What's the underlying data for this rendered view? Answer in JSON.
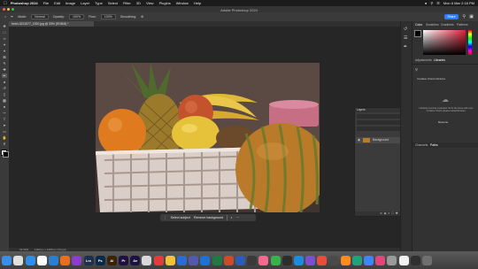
{
  "menubar": {
    "items": [
      "Photoshop 2024",
      "File",
      "Edit",
      "Image",
      "Layer",
      "Type",
      "Select",
      "Filter",
      "3D",
      "View",
      "Plugins",
      "Window",
      "Help"
    ],
    "clock": "Mon 6 Mar  2:18 PM"
  },
  "window": {
    "title": "Adobe Photoshop 2024"
  },
  "options": {
    "mode_label": "Mode:",
    "mode_value": "Normal",
    "opacity_label": "Opacity:",
    "opacity_value": "100%",
    "flow_label": "Flow:",
    "flow_value": "100%",
    "smoothing_label": "Smoothing:",
    "share_label": "Share"
  },
  "document": {
    "tab_title": "fresh-3221577_1920.jpg @ 33% (RGB/8) *"
  },
  "status": {
    "zoom": "33.33%",
    "info": "1920 px x 1280 px (72 ppi)"
  },
  "taskbar": {
    "select_subject": "Select subject",
    "remove_background": "Remove background"
  },
  "layers": {
    "header": "Layers",
    "layer_name": "Background"
  },
  "right_panel": {
    "tabs_top": [
      "Color",
      "Swatches",
      "Gradients",
      "Patterns"
    ],
    "tabs_mid": [
      "Adjustments",
      "Libraries"
    ],
    "libraries_title": "Creative Cloud Libraries",
    "libraries_msg": "Libraries syncing is paused. To fix the issue with your Creative Cloud, please reload libraries.",
    "resume_label": "Resume",
    "tabs_bottom": [
      "Channels",
      "Paths"
    ]
  },
  "dock_apps": [
    {
      "name": "Finder",
      "color": "#3a8ee6",
      "label": ""
    },
    {
      "name": "Launchpad",
      "color": "#e0e0e0",
      "label": ""
    },
    {
      "name": "Safari",
      "color": "#2f8fe8",
      "label": ""
    },
    {
      "name": "Chrome",
      "color": "#ffffff",
      "label": ""
    },
    {
      "name": "VS Code",
      "color": "#2a7fd1",
      "label": ""
    },
    {
      "name": "Firefox",
      "color": "#e8701c",
      "label": ""
    },
    {
      "name": "App1",
      "color": "#8a3ec9",
      "label": ""
    },
    {
      "name": "Lightroom Classic",
      "color": "#1d2f4a",
      "label": "Lrc"
    },
    {
      "name": "Photoshop",
      "color": "#0a2a4a",
      "label": "Ps"
    },
    {
      "name": "Illustrator",
      "color": "#3a2306",
      "label": "Ai"
    },
    {
      "name": "Premiere",
      "color": "#1f1040",
      "label": "Pr"
    },
    {
      "name": "After Effects",
      "color": "#1c1240",
      "label": "Ae"
    },
    {
      "name": "App2",
      "color": "#d8d8d8",
      "label": ""
    },
    {
      "name": "App3",
      "color": "#e23c3c",
      "label": ""
    },
    {
      "name": "App4",
      "color": "#f2c33a",
      "label": ""
    },
    {
      "name": "App5",
      "color": "#2b6bd6",
      "label": ""
    },
    {
      "name": "Teams",
      "color": "#5558af",
      "label": ""
    },
    {
      "name": "Outlook",
      "color": "#1e72d2",
      "label": ""
    },
    {
      "name": "Excel",
      "color": "#1f7a44",
      "label": ""
    },
    {
      "name": "PowerPoint",
      "color": "#cf4a26",
      "label": ""
    },
    {
      "name": "Word",
      "color": "#2b5cb7",
      "label": ""
    },
    {
      "name": "App6",
      "color": "#3a3a3a",
      "label": ""
    },
    {
      "name": "App7",
      "color": "#f26a8d",
      "label": ""
    },
    {
      "name": "App8",
      "color": "#37b24d",
      "label": ""
    },
    {
      "name": "App9",
      "color": "#2d2d2d",
      "label": ""
    },
    {
      "name": "App10",
      "color": "#1c8be0",
      "label": ""
    },
    {
      "name": "App11",
      "color": "#7b4fd1",
      "label": ""
    },
    {
      "name": "App12",
      "color": "#e84c3d",
      "label": ""
    },
    {
      "name": "App13",
      "color": "#4a4a4a",
      "label": ""
    },
    {
      "name": "App14",
      "color": "#ff8c1a",
      "label": ""
    },
    {
      "name": "App15",
      "color": "#1fa37a",
      "label": ""
    },
    {
      "name": "App16",
      "color": "#3d87f5",
      "label": ""
    },
    {
      "name": "App17",
      "color": "#e0457b",
      "label": ""
    },
    {
      "name": "App18",
      "color": "#9a9a9a",
      "label": ""
    },
    {
      "name": "App19",
      "color": "#f2f2f2",
      "label": ""
    },
    {
      "name": "App20",
      "color": "#2f2f2f",
      "label": ""
    },
    {
      "name": "Trash",
      "color": "#6f6f6f",
      "label": ""
    }
  ]
}
